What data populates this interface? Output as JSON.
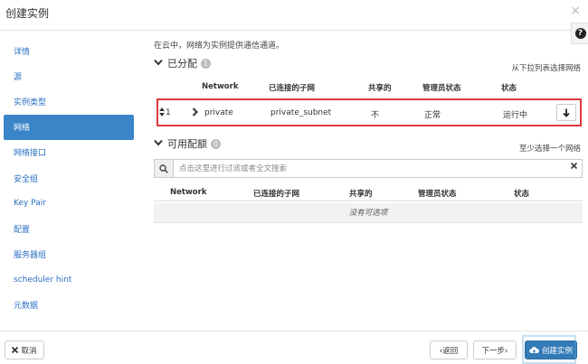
{
  "modal": {
    "title": "创建实例",
    "close_glyph": "×",
    "help_glyph": "?"
  },
  "sidebar": {
    "items": [
      {
        "label": "详情",
        "active": false
      },
      {
        "label": "源",
        "active": false
      },
      {
        "label": "实例类型",
        "active": false
      },
      {
        "label": "网络",
        "active": true
      },
      {
        "label": "网络接口",
        "active": false
      },
      {
        "label": "安全组",
        "active": false
      },
      {
        "label": "Key Pair",
        "active": false
      },
      {
        "label": "配置",
        "active": false
      },
      {
        "label": "服务器组",
        "active": false
      },
      {
        "label": "scheduler hint",
        "active": false
      },
      {
        "label": "元数据",
        "active": false
      }
    ]
  },
  "network": {
    "description": "在云中，网络为实例提供通信通道。",
    "allocated": {
      "title": "已分配",
      "count": "1",
      "hint": "从下拉列表选择网络",
      "columns": [
        "Network",
        "已连接的子网",
        "共享的",
        "管理员状态",
        "状态"
      ],
      "rows": [
        {
          "order": "1",
          "network": "private",
          "subnets": "private_subnet",
          "shared": "不",
          "admin_state": "正常",
          "status": "运行中"
        }
      ]
    },
    "available": {
      "title": "可用配额",
      "count": "0",
      "hint": "至少选择一个网络",
      "search_placeholder": "点击这里进行过滤或者全文搜索",
      "columns": [
        "Network",
        "已连接的子网",
        "共享的",
        "管理员状态",
        "状态"
      ],
      "empty_text": "没有可选项"
    }
  },
  "footer": {
    "cancel_label": "取消",
    "back_label": "‹返回",
    "next_label": "下一步›",
    "launch_label": "创建实例"
  },
  "colors": {
    "accent": "#337ab7",
    "sidebar_active": "#3a84c8",
    "link": "#2a6fc2",
    "highlight_border": "#e0393e"
  },
  "icons": [
    "close-icon",
    "help-icon",
    "chevron-down-icon",
    "sort-icon",
    "chevron-right-icon",
    "arrow-down-icon",
    "search-icon",
    "clear-icon",
    "times-icon",
    "cloud-upload-icon"
  ]
}
